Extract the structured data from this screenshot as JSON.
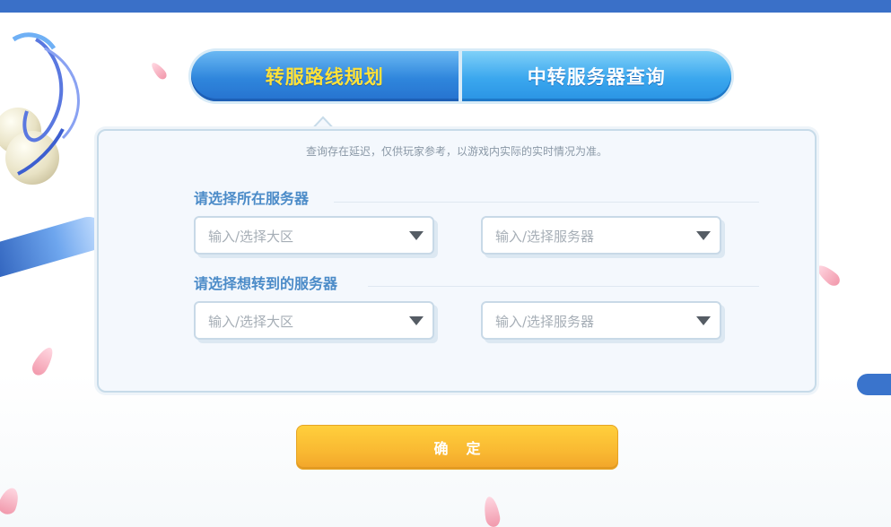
{
  "tabs": [
    {
      "label": "转服路线规划",
      "active": true
    },
    {
      "label": "中转服务器查询",
      "active": false
    }
  ],
  "notice": "查询存在延迟，仅供玩家参考，以游戏内实际的实时情况为准。",
  "current_server": {
    "title": "请选择所在服务器",
    "region_placeholder": "输入/选择大区",
    "server_placeholder": "输入/选择服务器"
  },
  "target_server": {
    "title": "请选择想转到的服务器",
    "region_placeholder": "输入/选择大区",
    "server_placeholder": "输入/选择服务器"
  },
  "confirm_label": "确定",
  "colors": {
    "accent": "#3a70c8",
    "tab_active_text": "#ffe23a",
    "section_title": "#4b8bc8",
    "confirm": "#f9b932"
  },
  "icons": {
    "dropdown": "triangle-down-icon"
  }
}
